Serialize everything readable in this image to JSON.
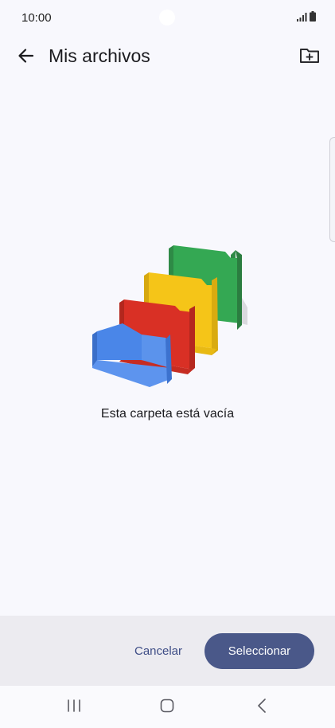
{
  "status_bar": {
    "time": "10:00",
    "icons": [
      "signal-icon",
      "battery-icon"
    ]
  },
  "app_bar": {
    "title": "Mis archivos",
    "back_icon": "arrow-back-icon",
    "new_folder_icon": "new-folder-icon"
  },
  "empty_state": {
    "illustration": "empty-folders-illustration",
    "message": "Esta carpeta está vacía"
  },
  "actions": {
    "cancel_label": "Cancelar",
    "select_label": "Seleccionar"
  },
  "nav_bar": {
    "icons": [
      "recent-apps-icon",
      "home-icon",
      "back-icon"
    ]
  },
  "colors": {
    "primary": "#4a5889",
    "accent_text": "#3e4d86",
    "background": "#f8f8fd",
    "bottom_panel": "#ecebf0",
    "folder_blue": "#4a86e8",
    "folder_red": "#d93025",
    "folder_yellow": "#f5c518",
    "folder_green": "#34a853"
  }
}
